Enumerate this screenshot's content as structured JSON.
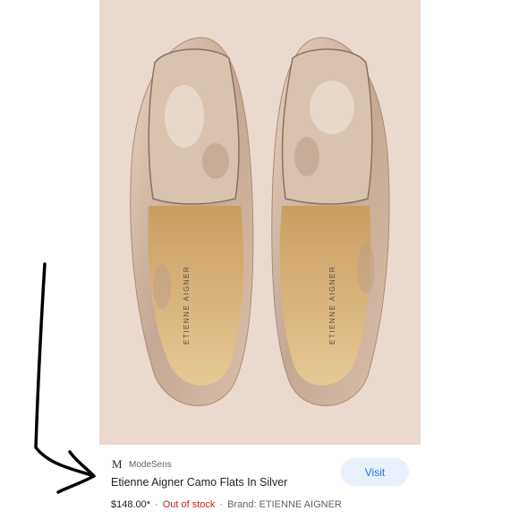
{
  "product_image": {
    "brand_imprint": "ETIENNE AIGNER",
    "colors": {
      "background": "#ead9cf",
      "shoe_metal": "#cdb29e",
      "insole": "#dbb987"
    }
  },
  "source": {
    "logo": "M",
    "name": "ModeSens"
  },
  "product": {
    "title": "Etienne Aigner Camo Flats In Silver",
    "price": "$148.00*",
    "separator": "·",
    "stock": "Out of stock",
    "brand": "Brand: ETIENNE AIGNER"
  },
  "actions": {
    "visit_label": "Visit"
  },
  "colors": {
    "visit_bg": "#e8f0fe",
    "visit_text": "#1a73e8",
    "stock_text": "#b3261e"
  },
  "annotation": {
    "icon": "hand-drawn-arrow-icon"
  }
}
